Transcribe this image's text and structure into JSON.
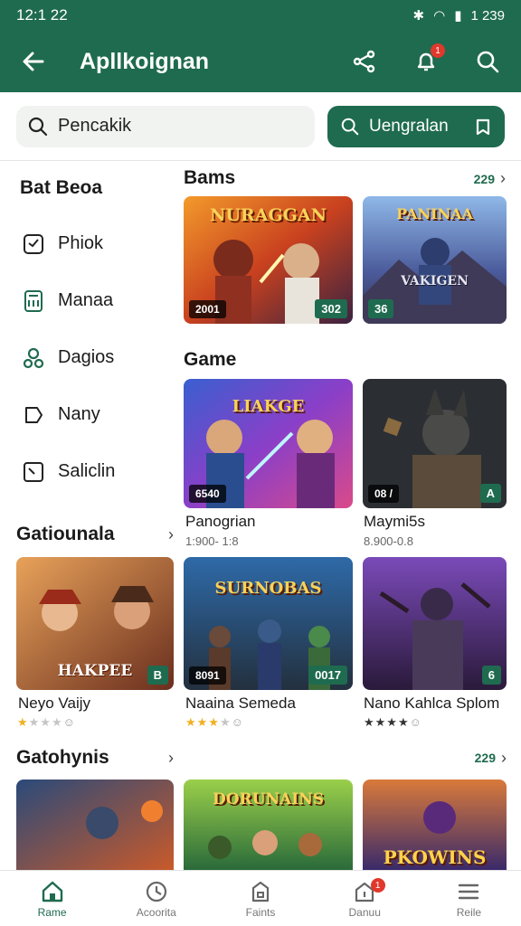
{
  "status": {
    "time": "12:1 22",
    "right": "1 239"
  },
  "appbar": {
    "title": "Apllkoignan",
    "notif_count": "1"
  },
  "search": {
    "value": "Pencakik"
  },
  "cta": {
    "label": "Uengralan"
  },
  "sidebar": {
    "title": "Bat Beoa",
    "items": [
      {
        "label": "Phiok"
      },
      {
        "label": "Manaa"
      },
      {
        "label": "Dagios"
      },
      {
        "label": "Nany"
      },
      {
        "label": "Saliclin"
      }
    ]
  },
  "sections": {
    "bams": {
      "title": "Bams",
      "more": "229"
    },
    "game": {
      "title": "Game"
    },
    "gatio": {
      "title": "Gatiounala"
    },
    "gatoy": {
      "title": "Gatohynis",
      "more": "229"
    }
  },
  "cards": {
    "bams1": {
      "art": "NURAGGAN",
      "tag_l": "2001",
      "tag_r": "302"
    },
    "bams2": {
      "art_top": "PANINAA",
      "art_bottom": "VAKIGEN",
      "tag_l": "36"
    },
    "game1": {
      "art": "LIAKGE",
      "tag_l": "6540"
    },
    "game2": {
      "tag_l": "08 /",
      "tag_r": "A"
    },
    "gat1": {
      "art": "HAKPEE",
      "tag_r": "B"
    },
    "gat2": {
      "art": "SURNOBAS",
      "tag_l": "8091",
      "tag_r": "0017"
    },
    "gat3": {
      "tag_r": "6"
    },
    "row4a": {
      "art": ""
    },
    "row4b": {
      "art": "DORUNAINS"
    },
    "row4c": {
      "art": "PKOWINS"
    }
  },
  "captions": {
    "game1": {
      "title": "Panogrian",
      "sub": "1:900- 1:8"
    },
    "game2": {
      "title": "Maymi5s",
      "sub": "8.900-0.8"
    },
    "gat1": {
      "title": "Neyo Vaijy",
      "rating": 1
    },
    "gat2": {
      "title": "Naaina Semeda",
      "rating": 3
    },
    "gat3": {
      "title": "Nano Kahlca Splom",
      "rating": 4
    }
  },
  "nav": [
    {
      "label": "Rame"
    },
    {
      "label": "Acoorita"
    },
    {
      "label": "Faints"
    },
    {
      "label": "Danuu"
    },
    {
      "label": "Reile"
    }
  ],
  "nav_badge": "1",
  "colors": {
    "primary": "#1f6b4f",
    "badge": "#e0382c"
  }
}
